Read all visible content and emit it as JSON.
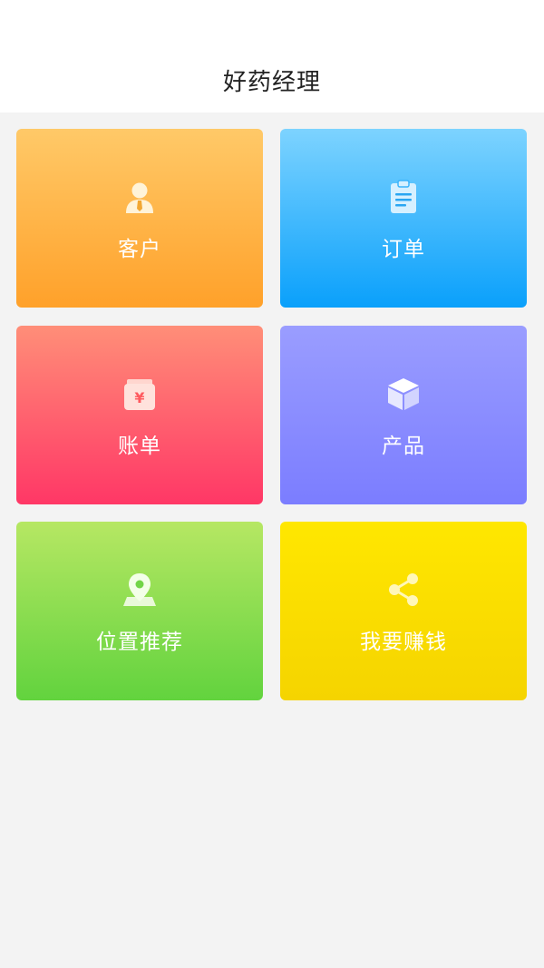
{
  "header": {
    "title": "好药经理"
  },
  "tiles": [
    {
      "label": "客户",
      "icon": "customer-icon"
    },
    {
      "label": "订单",
      "icon": "order-clipboard-icon"
    },
    {
      "label": "账单",
      "icon": "bill-yuan-icon"
    },
    {
      "label": "产品",
      "icon": "product-box-icon"
    },
    {
      "label": "位置推荐",
      "icon": "location-pin-icon"
    },
    {
      "label": "我要赚钱",
      "icon": "share-icon"
    }
  ],
  "colors": {
    "background": "#f3f3f3",
    "header": "#ffffff",
    "customers_gradient": [
      "#ffc968",
      "#ffa12a"
    ],
    "orders_gradient": [
      "#7dd3ff",
      "#0aa0fb"
    ],
    "bills_gradient": [
      "#ff8e78",
      "#ff3766"
    ],
    "products_gradient": [
      "#9a9dff",
      "#7b7dff"
    ],
    "location_gradient": [
      "#b6e763",
      "#62d33e"
    ],
    "earn_gradient": [
      "#ffe700",
      "#f5d400"
    ]
  }
}
